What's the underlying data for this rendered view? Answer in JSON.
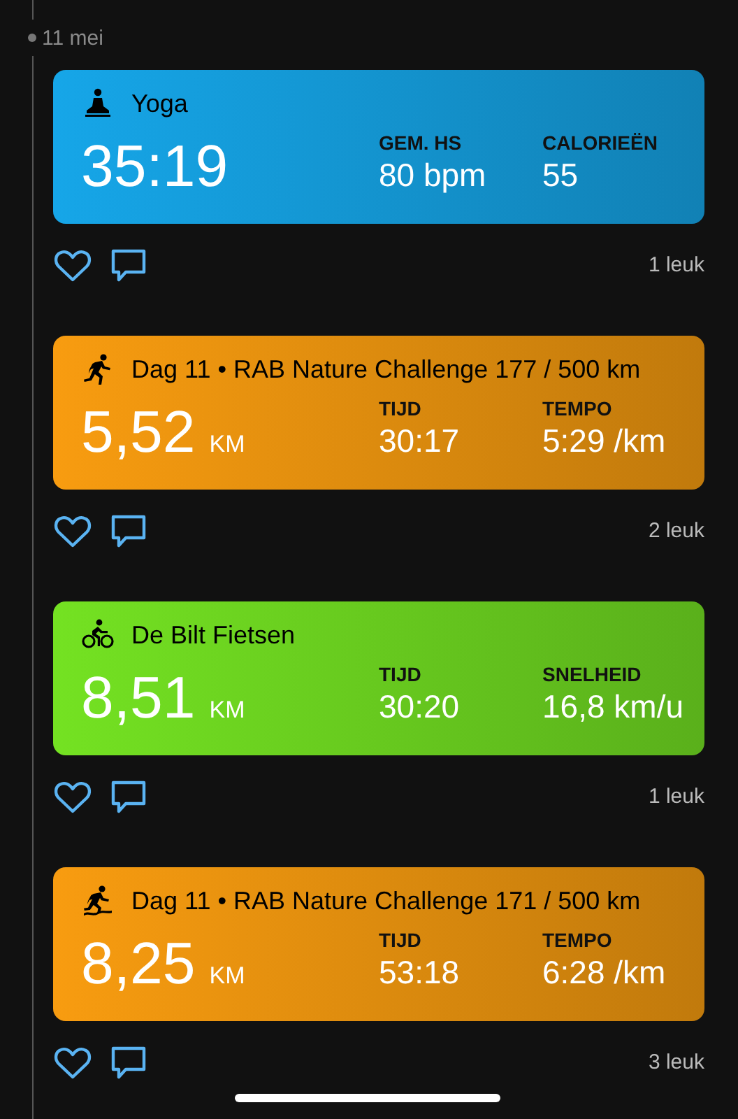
{
  "date": "11 mei",
  "activities": [
    {
      "kind": "yoga",
      "color": "#16a6e8",
      "title": "Yoga",
      "main_value": "35:19",
      "stats": [
        {
          "label": "GEM. HS",
          "value": "80 bpm"
        },
        {
          "label": "CALORIEËN",
          "value": "55"
        }
      ],
      "likes": "1 leuk"
    },
    {
      "kind": "run",
      "color": "#f89c10",
      "title": "Dag 11 • RAB Nature Challenge 177 / 500 km",
      "main_value": "5,52",
      "main_unit": "KM",
      "stats": [
        {
          "label": "TIJD",
          "value": "30:17"
        },
        {
          "label": "TEMPO",
          "value": "5:29 /km"
        }
      ],
      "likes": "2 leuk"
    },
    {
      "kind": "bike",
      "color": "#74e222",
      "title": "De Bilt Fietsen",
      "main_value": "8,51",
      "main_unit": "KM",
      "stats": [
        {
          "label": "TIJD",
          "value": "30:20"
        },
        {
          "label": "SNELHEID",
          "value": "16,8 km/u"
        }
      ],
      "likes": "1 leuk"
    },
    {
      "kind": "trail",
      "color": "#f89c10",
      "title": "Dag 11 • RAB Nature Challenge 171 / 500 km",
      "main_value": "8,25",
      "main_unit": "KM",
      "stats": [
        {
          "label": "TIJD",
          "value": "53:18"
        },
        {
          "label": "TEMPO",
          "value": "6:28 /km"
        }
      ],
      "likes": "3 leuk"
    }
  ]
}
